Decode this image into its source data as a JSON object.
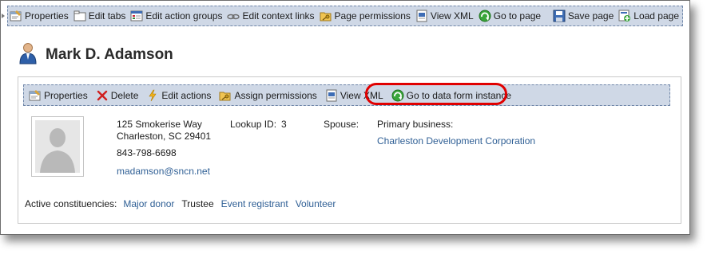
{
  "top_toolbar": {
    "items": [
      {
        "label": "Properties",
        "icon": "properties-icon"
      },
      {
        "label": "Edit tabs",
        "icon": "tabs-icon"
      },
      {
        "label": "Edit action groups",
        "icon": "action-groups-icon"
      },
      {
        "label": "Edit context links",
        "icon": "link-icon"
      },
      {
        "label": "Page permissions",
        "icon": "folder-key-icon"
      },
      {
        "label": "View XML",
        "icon": "xml-icon"
      },
      {
        "label": "Go to page",
        "icon": "go-arrow-icon"
      }
    ],
    "right_items": [
      {
        "label": "Save page",
        "icon": "save-icon"
      },
      {
        "label": "Load page",
        "icon": "load-icon"
      }
    ]
  },
  "page": {
    "title": "Mark D. Adamson",
    "title_icon": "person-icon"
  },
  "record_toolbar": {
    "items": [
      {
        "label": "Properties",
        "icon": "properties-icon"
      },
      {
        "label": "Delete",
        "icon": "delete-icon"
      },
      {
        "label": "Edit actions",
        "icon": "lightning-icon"
      },
      {
        "label": "Assign permissions",
        "icon": "folder-key-icon"
      },
      {
        "label": "View XML",
        "icon": "xml-icon"
      },
      {
        "label": "Go to data form instance",
        "icon": "go-arrow-icon"
      }
    ]
  },
  "constituent": {
    "address_line1": "125 Smokerise Way",
    "address_line2": "Charleston, SC  29401",
    "phone": "843-798-6698",
    "email": "madamson@sncn.net",
    "lookup_label": "Lookup ID:",
    "lookup_value": "3",
    "spouse_label": "Spouse:",
    "primary_business_label": "Primary business:",
    "primary_business_value": "Charleston Development Corporation"
  },
  "constituencies": {
    "label": "Active constituencies:",
    "items": [
      {
        "label": "Major donor",
        "link": true
      },
      {
        "label": "Trustee",
        "link": false
      },
      {
        "label": "Event registrant",
        "link": true
      },
      {
        "label": "Volunteer",
        "link": true
      }
    ]
  },
  "colors": {
    "toolbar_bg": "#cfd8e6",
    "toolbar_border": "#6f86a8",
    "link": "#2f5f95",
    "highlight": "#e00000"
  }
}
